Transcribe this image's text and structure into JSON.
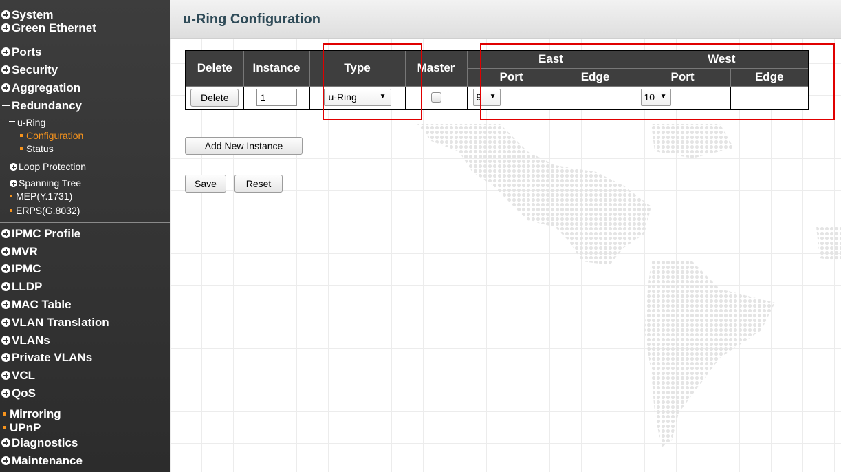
{
  "sidebar": {
    "items": [
      {
        "label": "System"
      },
      {
        "label": "Green Ethernet"
      },
      {
        "label": "Ports"
      },
      {
        "label": "Security"
      },
      {
        "label": "Aggregation"
      },
      {
        "label": "Redundancy"
      },
      {
        "label": "u-Ring"
      },
      {
        "label": "Configuration"
      },
      {
        "label": "Status"
      },
      {
        "label": "Loop Protection"
      },
      {
        "label": "Spanning Tree"
      },
      {
        "label": "MEP(Y.1731)"
      },
      {
        "label": "ERPS(G.8032)"
      },
      {
        "label": "IPMC Profile"
      },
      {
        "label": "MVR"
      },
      {
        "label": "IPMC"
      },
      {
        "label": "LLDP"
      },
      {
        "label": "MAC Table"
      },
      {
        "label": "VLAN Translation"
      },
      {
        "label": "VLANs"
      },
      {
        "label": "Private VLANs"
      },
      {
        "label": "VCL"
      },
      {
        "label": "QoS"
      },
      {
        "label": "Mirroring"
      },
      {
        "label": "UPnP"
      },
      {
        "label": "Diagnostics"
      },
      {
        "label": "Maintenance"
      }
    ]
  },
  "page": {
    "title": "u-Ring Configuration"
  },
  "table": {
    "headers": {
      "delete": "Delete",
      "instance": "Instance",
      "type": "Type",
      "master": "Master",
      "east": "East",
      "west": "West",
      "east_port": "Port",
      "east_edge": "Edge",
      "west_port": "Port",
      "west_edge": "Edge"
    },
    "rows": [
      {
        "delete_label": "Delete",
        "instance": "1",
        "type": "u-Ring",
        "master": false,
        "east_port": "9",
        "west_port": "10"
      }
    ]
  },
  "buttons": {
    "add_new_instance": "Add New Instance",
    "save": "Save",
    "reset": "Reset"
  },
  "colors": {
    "sidebar_bg": "#333333",
    "active_item": "#f7941d",
    "highlight_box": "#e00000",
    "title_text": "#2e4a57"
  }
}
